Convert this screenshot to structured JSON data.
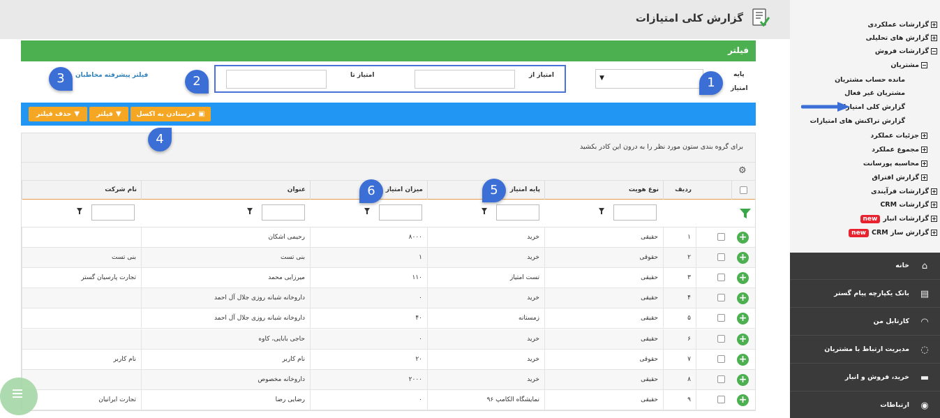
{
  "header": {
    "title": "گزارش کلی امتیازات"
  },
  "filter": {
    "title": "فیلتر",
    "base_label_line1": "پایه",
    "base_label_line2": "امتیاز",
    "base_select_value": "",
    "from_label": "امتیاز از",
    "to_label": "امتیاز تا",
    "from_value": "",
    "to_value": "",
    "advanced_link": "فیلتر پیشرفته مخاطبان"
  },
  "toolbar": {
    "excel_label": "فرستادن به اکسل",
    "filter_label": "فیلتر",
    "remove_filter_label": "حذف فیلتر"
  },
  "grid": {
    "group_hint": "برای گروه بندی ستون مورد نظر را به درون این کادر بکشید",
    "columns": [
      "ردیف",
      "نوع هویت",
      "پایه امتیاز",
      "میزان امتیاز",
      "عنوان",
      "نام شرکت"
    ],
    "rows": [
      {
        "num": "۱",
        "type": "حقیقی",
        "base": "خرید",
        "amount": "۸۰۰۰",
        "title": "رحیمی اشکان",
        "company": ""
      },
      {
        "num": "۲",
        "type": "حقوقی",
        "base": "خرید",
        "amount": "۱",
        "title": "بنی تست",
        "company": "بنی تست"
      },
      {
        "num": "۳",
        "type": "حقیقی",
        "base": "تست امتیاز",
        "amount": "۱۱۰",
        "title": "میرزایی محمد",
        "company": "تجارت پارسیان گستر"
      },
      {
        "num": "۴",
        "type": "حقیقی",
        "base": "خرید",
        "amount": "۰",
        "title": "داروخانه شبانه روزی جلال آل احمد",
        "company": ""
      },
      {
        "num": "۵",
        "type": "حقیقی",
        "base": "زمستانه",
        "amount": "۴۰",
        "title": "داروخانه شبانه روزی جلال آل احمد",
        "company": ""
      },
      {
        "num": "۶",
        "type": "حقیقی",
        "base": "خرید",
        "amount": "۰",
        "title": "حاجی بابایی، کاوه",
        "company": ""
      },
      {
        "num": "۷",
        "type": "حقوقی",
        "base": "خرید",
        "amount": "۲۰",
        "title": "نام کاربر",
        "company": "نام کاربر"
      },
      {
        "num": "۸",
        "type": "حقیقی",
        "base": "خرید",
        "amount": "۲۰۰۰",
        "title": "داروخانه مخصوص",
        "company": ""
      },
      {
        "num": "۹",
        "type": "حقیقی",
        "base": "نمایشگاه الکامپ ۹۶",
        "amount": "۰",
        "title": "رضایی رضا",
        "company": "تجارت ایرانیان"
      }
    ]
  },
  "markers": [
    "1",
    "2",
    "3",
    "4",
    "5",
    "6"
  ],
  "sidebar": {
    "tree": [
      {
        "label": "گزارشات عملکردی",
        "icon": "plus"
      },
      {
        "label": "گزارش های تحلیلی",
        "icon": "plus"
      },
      {
        "label": "گزارشات فروش",
        "icon": "minus"
      },
      {
        "label": "مشتریان",
        "icon": "minus"
      },
      {
        "label": "مانده حساب مشتریان",
        "icon": ""
      },
      {
        "label": "مشتریان غیر فعال",
        "icon": ""
      },
      {
        "label": "گزارش کلی امتیازات",
        "icon": ""
      },
      {
        "label": "گزارش تراکنش های امتیازات",
        "icon": ""
      },
      {
        "label": "جزئیات عملکرد",
        "icon": "plus"
      },
      {
        "label": "مجموع عملکرد",
        "icon": "plus"
      },
      {
        "label": "محاسبه پورسانت",
        "icon": "plus"
      },
      {
        "label": "گزارش افتراق",
        "icon": "plus"
      },
      {
        "label": "گزارشات فرآیندی",
        "icon": "plus"
      },
      {
        "label": "گزارشات CRM",
        "icon": "plus"
      },
      {
        "label": "گزارشات انبار",
        "icon": "plus",
        "badge": "new"
      },
      {
        "label": "گزارش ساز CRM",
        "icon": "plus",
        "badge": "new"
      }
    ],
    "nav": [
      {
        "label": "خانه",
        "icon": "home-icon"
      },
      {
        "label": "بانک یکپارچه پیام گستر",
        "icon": "bank-icon"
      },
      {
        "label": "کارتابل من",
        "icon": "dashboard-icon"
      },
      {
        "label": "مدیریت ارتباط با مشتریان",
        "icon": "crm-icon"
      },
      {
        "label": "خرید، فروش و انبار",
        "icon": "truck-icon"
      },
      {
        "label": "ارتباطات",
        "icon": "broadcast-icon"
      }
    ]
  },
  "colors": {
    "green": "#4caf50",
    "blue": "#2196f3",
    "orange": "#f5a623",
    "marker": "#3c6fd6",
    "badge": "#e8222e"
  }
}
